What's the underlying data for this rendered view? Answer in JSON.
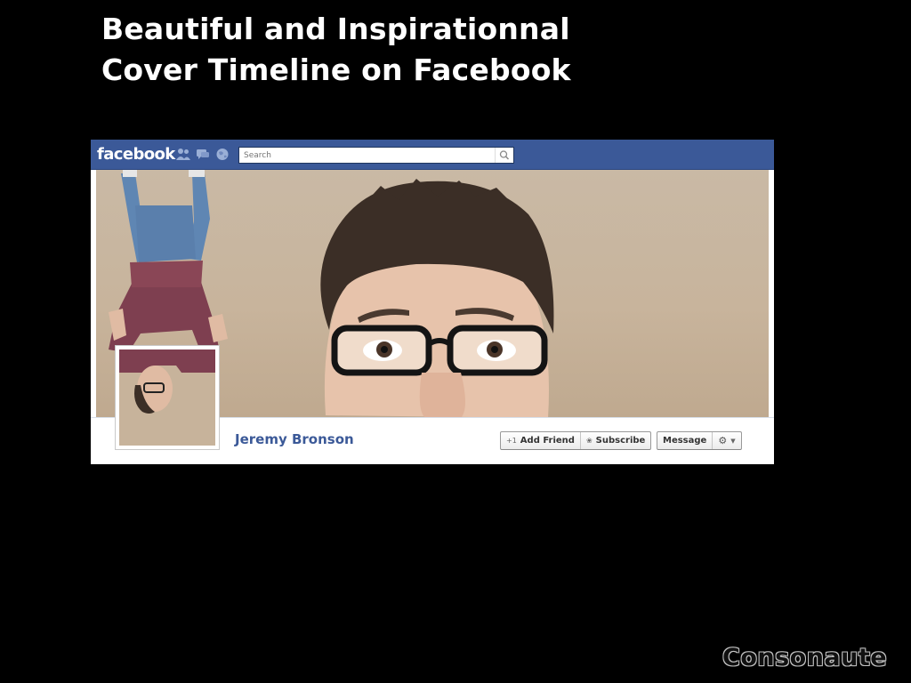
{
  "slide": {
    "title_line1": "Beautiful and Inspirationnal",
    "title_line2": "Cover Timeline on Facebook"
  },
  "facebook": {
    "logo": "facebook",
    "nav_icons": [
      "friend-requests-icon",
      "messages-icon",
      "notifications-globe-icon"
    ],
    "search": {
      "placeholder": "Search",
      "icon": "magnifier-icon"
    },
    "profile": {
      "name": "Jeremy Bronson",
      "buttons": {
        "add_friend": "Add Friend",
        "subscribe": "Subscribe",
        "message": "Message"
      },
      "settings_icon": "gear-icon"
    },
    "colors": {
      "bar": "#3b5998",
      "name": "#3b5998",
      "cover": "#c9b9a5"
    }
  },
  "watermark": "Consonaute"
}
